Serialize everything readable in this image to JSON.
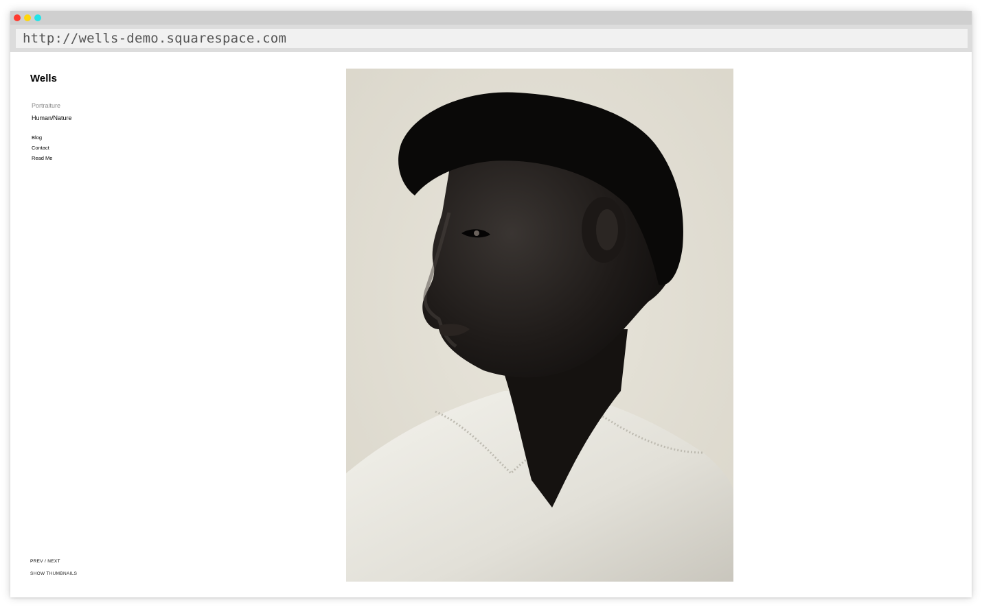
{
  "browser": {
    "url": "http://wells-demo.squarespace.com",
    "traffic_lights": {
      "close": "#ff3b30",
      "minimize": "#ffd60a",
      "zoom": "#22e3e8"
    }
  },
  "site": {
    "title": "Wells",
    "gallery_nav": [
      {
        "label": "Portraiture",
        "active": false
      },
      {
        "label": "Human/Nature",
        "active": true
      }
    ],
    "page_nav": [
      {
        "label": "Blog"
      },
      {
        "label": "Contact"
      },
      {
        "label": "Read Me"
      }
    ],
    "pager": {
      "prev": "PREV",
      "separator": " / ",
      "next": "NEXT"
    },
    "thumbnails_toggle": "SHOW THUMBNAILS"
  },
  "colors": {
    "photo_background": "#e4e1d6",
    "text": "#000000",
    "muted_text": "#8a8a8a"
  }
}
